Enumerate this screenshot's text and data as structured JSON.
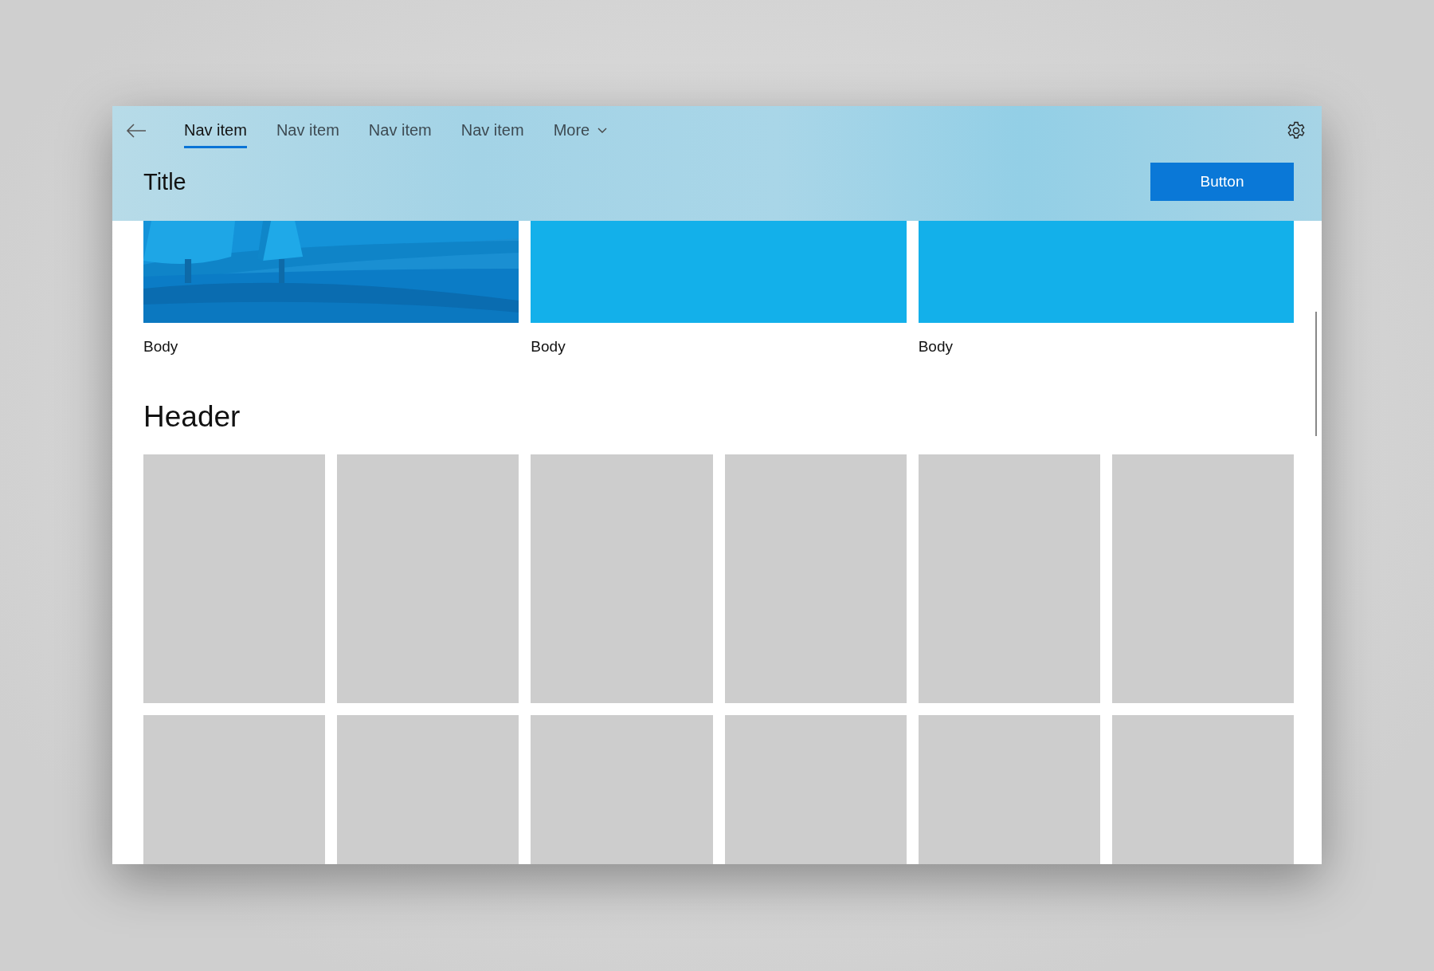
{
  "nav": {
    "items": [
      {
        "label": "Nav item",
        "selected": true
      },
      {
        "label": "Nav item",
        "selected": false
      },
      {
        "label": "Nav item",
        "selected": false
      },
      {
        "label": "Nav item",
        "selected": false
      }
    ],
    "more": "More"
  },
  "title": "Title",
  "button": "Button",
  "cards": [
    {
      "kind": "picture",
      "body": "Body"
    },
    {
      "kind": "color-block",
      "body": "Body"
    },
    {
      "kind": "color-block",
      "body": "Body"
    }
  ],
  "section": {
    "header": "Header",
    "tiles": [
      {
        "kind": "placeholder"
      },
      {
        "kind": "placeholder"
      },
      {
        "kind": "placeholder"
      },
      {
        "kind": "placeholder"
      },
      {
        "kind": "placeholder"
      },
      {
        "kind": "placeholder"
      },
      {
        "kind": "placeholder"
      },
      {
        "kind": "placeholder"
      },
      {
        "kind": "placeholder"
      },
      {
        "kind": "placeholder"
      },
      {
        "kind": "placeholder"
      },
      {
        "kind": "placeholder"
      }
    ]
  }
}
